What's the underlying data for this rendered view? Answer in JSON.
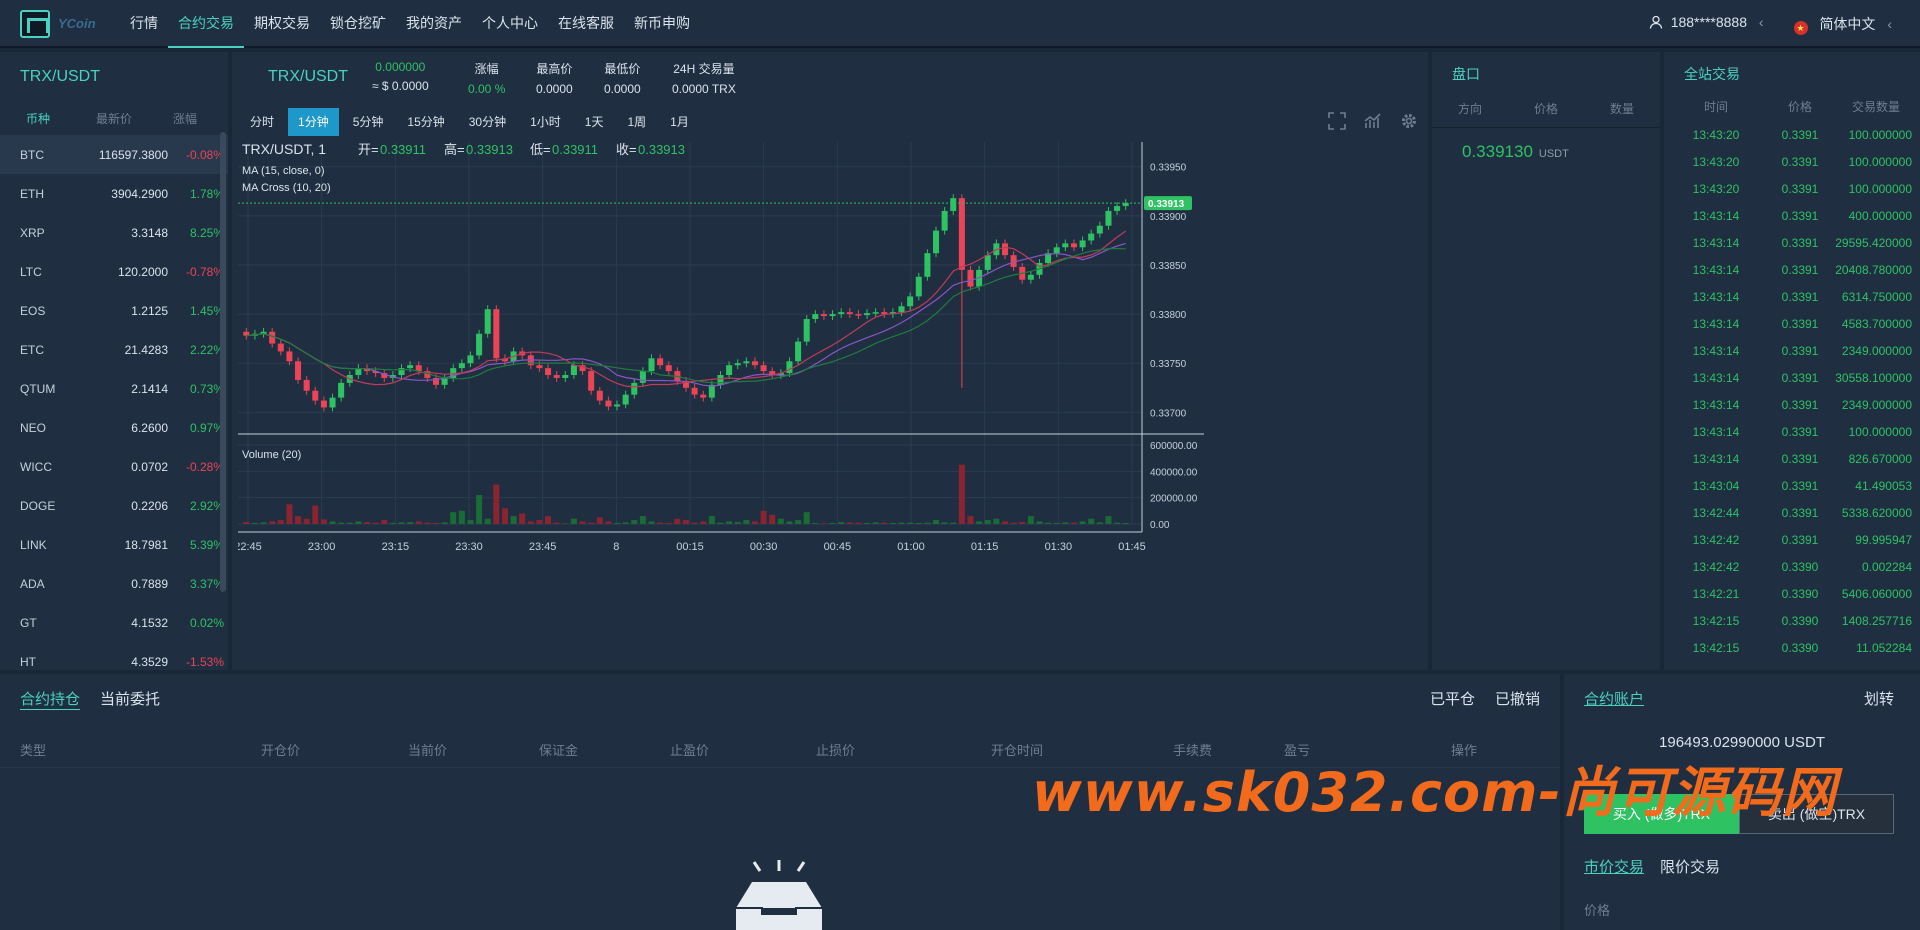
{
  "nav": {
    "logo_text": "YCoin",
    "menu": [
      "行情",
      "合约交易",
      "期权交易",
      "锁仓挖矿",
      "我的资产",
      "个人中心",
      "在线客服",
      "新币申购"
    ],
    "active_index": 1,
    "user": "188****8888",
    "user_arrow": "‹",
    "lang_flag": "★",
    "lang": "简体中文",
    "lang_arrow": "‹"
  },
  "market": {
    "pair": "TRX/USDT",
    "headers": [
      "币种",
      "最新价",
      "涨幅"
    ],
    "rows": [
      {
        "sym": "BTC",
        "price": "116597.3800",
        "change": "-0.08%",
        "dir": "dn"
      },
      {
        "sym": "ETH",
        "price": "3904.2900",
        "change": "1.78%",
        "dir": "up"
      },
      {
        "sym": "XRP",
        "price": "3.3148",
        "change": "8.25%",
        "dir": "up"
      },
      {
        "sym": "LTC",
        "price": "120.2000",
        "change": "-0.78%",
        "dir": "dn"
      },
      {
        "sym": "EOS",
        "price": "1.2125",
        "change": "1.45%",
        "dir": "up"
      },
      {
        "sym": "ETC",
        "price": "21.4283",
        "change": "2.22%",
        "dir": "up"
      },
      {
        "sym": "QTUM",
        "price": "2.1414",
        "change": "0.73%",
        "dir": "up"
      },
      {
        "sym": "NEO",
        "price": "6.2600",
        "change": "0.97%",
        "dir": "up"
      },
      {
        "sym": "WICC",
        "price": "0.0702",
        "change": "-0.28%",
        "dir": "dn"
      },
      {
        "sym": "DOGE",
        "price": "0.2206",
        "change": "2.92%",
        "dir": "up"
      },
      {
        "sym": "LINK",
        "price": "18.7981",
        "change": "5.39%",
        "dir": "up"
      },
      {
        "sym": "ADA",
        "price": "0.7889",
        "change": "3.37%",
        "dir": "up"
      },
      {
        "sym": "GT",
        "price": "4.1532",
        "change": "0.02%",
        "dir": "up"
      },
      {
        "sym": "HT",
        "price": "4.3529",
        "change": "-1.53%",
        "dir": "dn"
      }
    ]
  },
  "ticker": {
    "pair": "TRX/USDT",
    "last": "0.000000",
    "last_usd": "≈ $ 0.0000",
    "change_label": "涨幅",
    "change": "0.00 %",
    "high_label": "最高价",
    "high": "0.0000",
    "low_label": "最低价",
    "low": "0.0000",
    "vol_label": "24H 交易量",
    "vol": "0.0000 TRX"
  },
  "intervals": [
    "分时",
    "1分钟",
    "5分钟",
    "15分钟",
    "30分钟",
    "1小时",
    "1天",
    "1周",
    "1月"
  ],
  "active_interval": 1,
  "chart_data": {
    "type": "candlestick",
    "symbol_label": "TRX/USDT, 1",
    "ohlc_labels": {
      "open": "开=",
      "high": "高=",
      "low": "低=",
      "close": "收="
    },
    "ohlc": {
      "open": "0.33911",
      "high": "0.33913",
      "low": "0.33911",
      "close": "0.33913"
    },
    "indicators": [
      "MA (15, close, 0)",
      "MA Cross (10, 20)"
    ],
    "volume_label": "Volume (20)",
    "price_ticks": [
      "0.33950",
      "0.33900",
      "0.33850",
      "0.33800",
      "0.33750",
      "0.33700"
    ],
    "price_tick_values": [
      0.3395,
      0.339,
      0.3385,
      0.338,
      0.3375,
      0.337
    ],
    "price_range": [
      0.3368,
      0.33965
    ],
    "last_price": "0.33913",
    "last_price_value": 0.33913,
    "volume_ticks": [
      "600000.00",
      "400000.00",
      "200000.00",
      "0.00"
    ],
    "volume_tick_values": [
      600000,
      400000,
      200000,
      0
    ],
    "volume_range": [
      0,
      600000
    ],
    "x_ticks": [
      "22:45",
      "23:00",
      "23:15",
      "23:30",
      "23:45",
      "8",
      "00:15",
      "00:30",
      "00:45",
      "01:00",
      "01:15",
      "01:30",
      "01:45"
    ],
    "closes": [
      0.33778,
      0.3378,
      0.33782,
      0.3377,
      0.33762,
      0.33752,
      0.33733,
      0.33722,
      0.33712,
      0.33705,
      0.33715,
      0.3373,
      0.33738,
      0.33745,
      0.33742,
      0.3374,
      0.33735,
      0.33738,
      0.33745,
      0.33748,
      0.33742,
      0.33735,
      0.33728,
      0.33735,
      0.33745,
      0.3375,
      0.33758,
      0.3378,
      0.33805,
      0.33755,
      0.33752,
      0.33762,
      0.33758,
      0.33748,
      0.33745,
      0.33738,
      0.33735,
      0.33738,
      0.33748,
      0.33742,
      0.33722,
      0.33712,
      0.33706,
      0.33708,
      0.33718,
      0.3373,
      0.33742,
      0.33755,
      0.33748,
      0.33742,
      0.33732,
      0.33725,
      0.33718,
      0.33715,
      0.33728,
      0.33738,
      0.33748,
      0.3375,
      0.33752,
      0.33748,
      0.33742,
      0.33738,
      0.3374,
      0.33752,
      0.33772,
      0.33795,
      0.338,
      0.33798,
      0.338,
      0.33802,
      0.338,
      0.33799,
      0.33801,
      0.33802,
      0.338,
      0.33802,
      0.33808,
      0.33818,
      0.33838,
      0.33862,
      0.33885,
      0.33905,
      0.33918,
      0.33845,
      0.33828,
      0.33845,
      0.3386,
      0.33872,
      0.3386,
      0.33848,
      0.33835,
      0.3384,
      0.33852,
      0.33862,
      0.33868,
      0.33872,
      0.33868,
      0.33875,
      0.33882,
      0.3389,
      0.33905,
      0.3391,
      0.33913
    ],
    "volumes": [
      15000,
      8000,
      12000,
      20000,
      30000,
      150000,
      60000,
      40000,
      140000,
      35000,
      20000,
      10000,
      10000,
      20000,
      15000,
      10000,
      30000,
      8000,
      12000,
      15000,
      20000,
      10000,
      8000,
      12000,
      90000,
      100000,
      30000,
      220000,
      40000,
      300000,
      120000,
      60000,
      80000,
      20000,
      30000,
      60000,
      10000,
      5000,
      40000,
      20000,
      10000,
      50000,
      20000,
      8000,
      12000,
      30000,
      60000,
      20000,
      10000,
      8000,
      40000,
      30000,
      10000,
      20000,
      60000,
      10000,
      20000,
      15000,
      30000,
      20000,
      100000,
      70000,
      40000,
      20000,
      30000,
      90000,
      8000,
      5000,
      8000,
      15000,
      12000,
      10000,
      8000,
      12000,
      10000,
      8000,
      10000,
      10000,
      8000,
      10000,
      30000,
      12000,
      10000,
      450000,
      60000,
      20000,
      30000,
      40000,
      20000,
      10000,
      15000,
      60000,
      20000,
      10000,
      8000,
      12000,
      10000,
      20000,
      40000,
      12000,
      60000,
      10000,
      8000
    ]
  },
  "book": {
    "title": "盘口",
    "headers": [
      "方向",
      "价格",
      "数量"
    ],
    "price": "0.339130",
    "unit": "USDT"
  },
  "trades": {
    "title": "全站交易",
    "headers": [
      "时间",
      "价格",
      "交易数量"
    ],
    "rows": [
      [
        "13:43:20",
        "0.3391",
        "100.000000"
      ],
      [
        "13:43:20",
        "0.3391",
        "100.000000"
      ],
      [
        "13:43:20",
        "0.3391",
        "100.000000"
      ],
      [
        "13:43:14",
        "0.3391",
        "400.000000"
      ],
      [
        "13:43:14",
        "0.3391",
        "29595.420000"
      ],
      [
        "13:43:14",
        "0.3391",
        "20408.780000"
      ],
      [
        "13:43:14",
        "0.3391",
        "6314.750000"
      ],
      [
        "13:43:14",
        "0.3391",
        "4583.700000"
      ],
      [
        "13:43:14",
        "0.3391",
        "2349.000000"
      ],
      [
        "13:43:14",
        "0.3391",
        "30558.100000"
      ],
      [
        "13:43:14",
        "0.3391",
        "2349.000000"
      ],
      [
        "13:43:14",
        "0.3391",
        "100.000000"
      ],
      [
        "13:43:14",
        "0.3391",
        "826.670000"
      ],
      [
        "13:43:04",
        "0.3391",
        "41.490053"
      ],
      [
        "13:42:44",
        "0.3391",
        "5338.620000"
      ],
      [
        "13:42:42",
        "0.3391",
        "99.995947"
      ],
      [
        "13:42:42",
        "0.3390",
        "0.002284"
      ],
      [
        "13:42:21",
        "0.3390",
        "5406.060000"
      ],
      [
        "13:42:15",
        "0.3390",
        "1408.257716"
      ],
      [
        "13:42:15",
        "0.3390",
        "11.052284"
      ]
    ]
  },
  "positions": {
    "tabs": [
      "合约持仓",
      "当前委托"
    ],
    "right_tabs": [
      "已平仓",
      "已撤销"
    ],
    "columns": [
      "类型",
      "开仓价",
      "当前价",
      "保证金",
      "止盈价",
      "止损价",
      "开仓时间",
      "手续费",
      "盈亏",
      "操作"
    ]
  },
  "account": {
    "title": "合约账户",
    "transfer": "划转",
    "balance": "196493.02990000 USDT",
    "buy": "买入 (做多)TRX",
    "sell": "卖出 (做空)TRX",
    "order_tabs": [
      "市价交易",
      "限价交易"
    ],
    "price_label": "价格"
  },
  "watermark": "www.sk032.com-尚可源码网",
  "colors": {
    "accent": "#4bd1c1",
    "up": "#2ec263",
    "down": "#ea4456",
    "active_tab": "#1e97c9"
  }
}
